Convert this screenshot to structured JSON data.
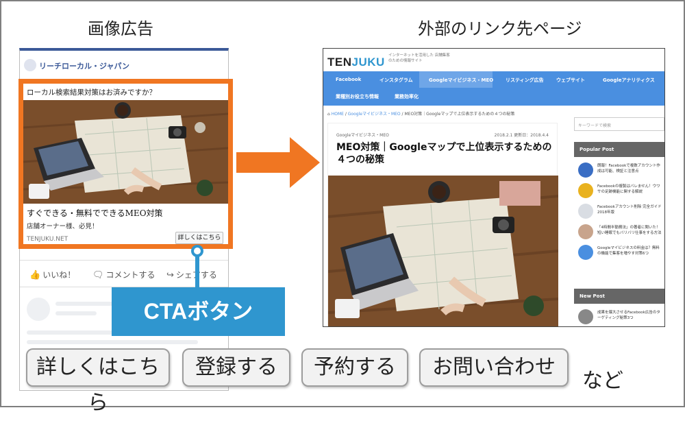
{
  "headings": {
    "left": "画像広告",
    "right": "外部のリンク先ページ"
  },
  "facebook_ad": {
    "page_name": "リーチローカル・ジャパン",
    "question": "ローカル検索結果対策はお済みですか？",
    "title": "すぐできる・無料でできるMEO対策",
    "subtitle": "店舗オーナー様、必見！",
    "domain": "TENJUKU.NET",
    "cta_button": "詳しくはこちら",
    "actions": {
      "like": "いいね！",
      "comment": "コメントする",
      "share": "シェアする"
    }
  },
  "cta_label": "CTAボタン",
  "site": {
    "logo_a": "TEN",
    "logo_b": "JUKU",
    "tagline": "インターネットを活用した 店舗集客のための情報サイト",
    "nav": [
      "Facebook",
      "インスタグラム",
      "Googleマイビジネス・MEO",
      "リスティング広告",
      "ウェブサイト",
      "Googleアナリティクス",
      "業種別お役立ち情報",
      "業務効率化"
    ],
    "breadcrumb_home": "HOME",
    "breadcrumb_cat": "Googleマイビジネス・MEO",
    "breadcrumb_page": "MEO対策｜Googleマップで上位表示するための４つの秘策",
    "article_category": "Googleマイビジネス・MEO",
    "article_date": "2018.2.1 更新日：2018.4.4",
    "article_title": "MEO対策｜Googleマップで上位表示するための４つの秘策",
    "search_placeholder": "キーワードで検索",
    "popular_heading": "Popular Post",
    "popular_posts": [
      "朗報！Facebookで複数アカウント作成は可能、検証と注意点",
      "Facebookの複製はバレません！ウワサの足跡機能に関する解説",
      "Facebookアカウント削除 完全ガイド2018年版",
      "「4時間半勤務法」の著者に聞いた！短い睡眠でもバリバリ仕事をする方法",
      "Googleマイビジネスの料金は？無料の機能で集客を増やす対策6つ"
    ],
    "new_heading": "New Post",
    "new_posts": [
      "成果を爆大させるFacebook広告のターゲティング秘策3つ"
    ]
  },
  "cta_examples": [
    "詳しくはこちら",
    "登録する",
    "予約する",
    "お問い合わせ"
  ],
  "trailing_text": "など",
  "colors": {
    "orange": "#f07622",
    "blue": "#2f96cf",
    "nav_blue": "#4a8fe0"
  }
}
